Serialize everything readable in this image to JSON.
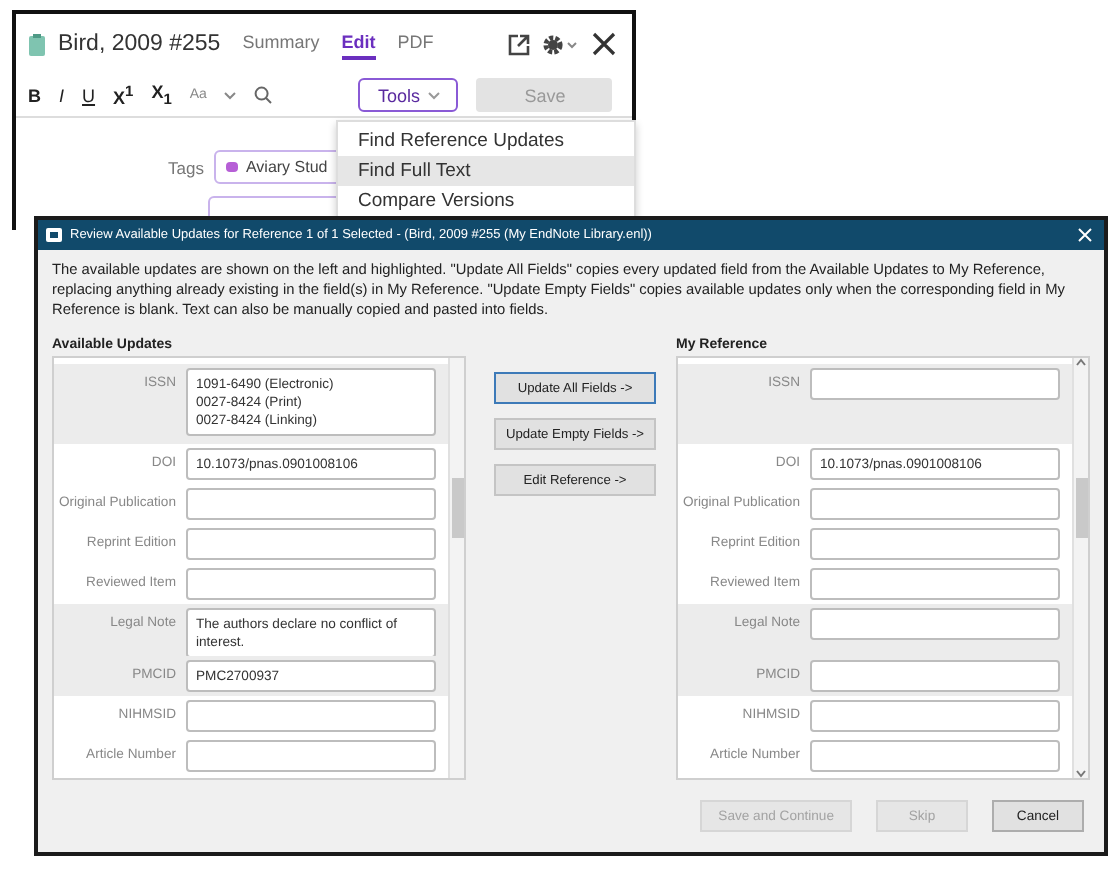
{
  "reference_window": {
    "title": "Bird, 2009 #255",
    "tabs": [
      {
        "label": "Summary",
        "selected": false
      },
      {
        "label": "Edit",
        "selected": true
      },
      {
        "label": "PDF",
        "selected": false
      }
    ],
    "format_toolbar": [
      {
        "kind": "bold",
        "label": "B"
      },
      {
        "kind": "italic",
        "label": "I"
      },
      {
        "kind": "underline",
        "label": "U"
      },
      {
        "kind": "script",
        "label": "X$^{1}$"
      },
      {
        "kind": "script",
        "label": "X$_{1}$"
      },
      {
        "kind": "case",
        "label": "Aa"
      }
    ],
    "tools_button": {
      "label": "Tools",
      "expanded": true
    },
    "save_button": {
      "label": "Save",
      "disabled": true
    },
    "tags": {
      "label": "Tags",
      "value": "Aviary Stud",
      "color": "#b65fd6"
    },
    "tools_menu": [
      {
        "label": "Find Reference Updates",
        "selected": false
      },
      {
        "label": "Find Full Text",
        "selected": true
      },
      {
        "label": "Compare Versions",
        "selected": false
      }
    ]
  },
  "dialog": {
    "title": "Review Available Updates for Reference 1 of 1 Selected - (Bird, 2009 #255 (My EndNote Library.enl))",
    "description": "The available updates are shown on the left and highlighted. \"Update All Fields\" copies every updated field from the Available Updates to My Reference, replacing anything already existing in the field(s) in My Reference. \"Update Empty Fields\" copies available updates only when the corresponding field in My Reference is blank. Text can also be manually copied and pasted into fields.",
    "available_heading": "Available Updates",
    "available_fields": [
      {
        "label": "ISSN",
        "value": "1091-6490 (Electronic)\n0027-8424 (Print)\n0027-8424 (Linking)",
        "highlighted": true
      },
      {
        "label": "DOI",
        "value": "10.1073/pnas.0901008106",
        "highlighted": false
      },
      {
        "label": "Original Publication",
        "highlighted": false
      },
      {
        "label": "Reprint Edition",
        "highlighted": false
      },
      {
        "label": "Reviewed Item",
        "highlighted": false
      },
      {
        "label": "Legal Note",
        "value": "The authors declare no conflict of\ninterest.",
        "highlighted": true
      },
      {
        "label": "PMCID",
        "value": "PMC2700937",
        "highlighted": true
      },
      {
        "label": "NIHMSID",
        "highlighted": false
      },
      {
        "label": "Article Number",
        "highlighted": false
      }
    ],
    "actions": [
      {
        "label": "Update All Fields ->",
        "focused": true
      },
      {
        "label": "Update Empty Fields ->",
        "focused": false
      },
      {
        "label": "Edit Reference ->",
        "focused": false
      }
    ],
    "reference_heading": "My Reference",
    "reference_fields": [
      {
        "label": "ISSN",
        "highlighted": true
      },
      {
        "label": "DOI",
        "value": "10.1073/pnas.0901008106",
        "highlighted": false
      },
      {
        "label": "Original Publication",
        "highlighted": false
      },
      {
        "label": "Reprint Edition",
        "highlighted": false
      },
      {
        "label": "Reviewed Item",
        "highlighted": false
      },
      {
        "label": "Legal Note",
        "highlighted": true
      },
      {
        "label": "PMCID",
        "highlighted": true
      },
      {
        "label": "NIHMSID",
        "highlighted": false
      },
      {
        "label": "Article Number",
        "highlighted": false
      }
    ],
    "footer_buttons": [
      {
        "label": "Save and Continue",
        "disabled": true
      },
      {
        "label": "Skip",
        "disabled": true
      },
      {
        "label": "Cancel",
        "disabled": false
      }
    ]
  }
}
